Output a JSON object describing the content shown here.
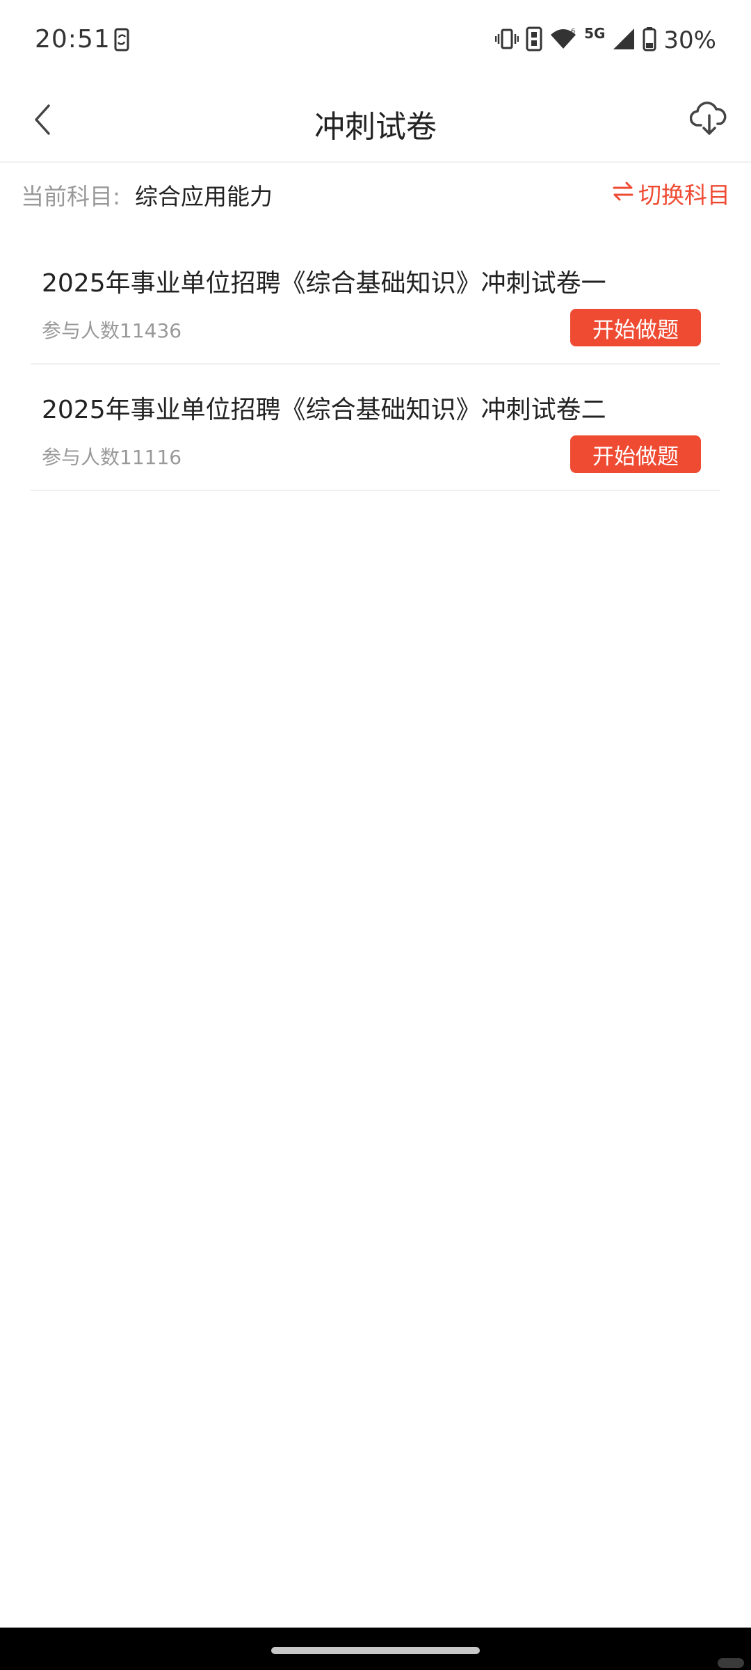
{
  "status_bar": {
    "time": "20:51",
    "network": "5G",
    "battery": "30%",
    "icons": [
      "phone-sync-icon",
      "vibrate-icon",
      "volte-icon",
      "wifi-icon",
      "signal-icon",
      "battery-icon"
    ]
  },
  "header": {
    "title": "冲刺试卷",
    "back_icon": "chevron-left-icon",
    "download_icon": "cloud-download-icon"
  },
  "subject_bar": {
    "label": "当前科目:",
    "value": "综合应用能力",
    "switch_label": "切换科目",
    "switch_icon": "swap-arrows-icon"
  },
  "papers": [
    {
      "title": "2025年事业单位招聘《综合基础知识》冲刺试卷一",
      "participants": "参与人数11436",
      "action": "开始做题"
    },
    {
      "title": "2025年事业单位招聘《综合基础知识》冲刺试卷二",
      "participants": "参与人数11116",
      "action": "开始做题"
    }
  ],
  "colors": {
    "accent": "#ef4b33",
    "text_primary": "#222222",
    "text_secondary": "#999999",
    "divider": "#f0f0f0"
  }
}
